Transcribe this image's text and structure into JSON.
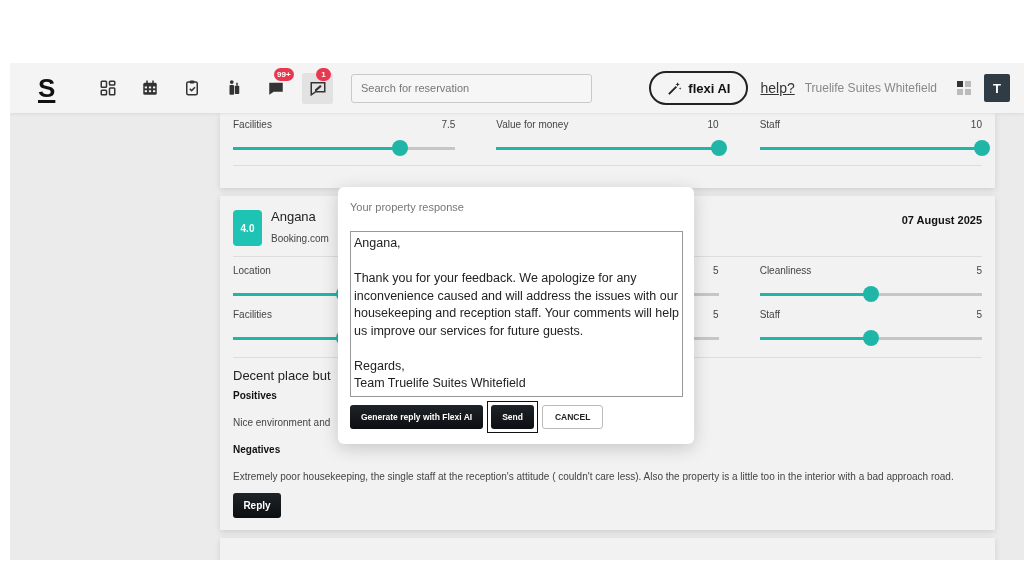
{
  "header": {
    "logo": "S",
    "nav": [
      {
        "kind": "dashboard",
        "selected": false
      },
      {
        "kind": "calendar",
        "selected": false
      },
      {
        "kind": "tasks",
        "selected": false
      },
      {
        "kind": "luggage",
        "selected": false
      },
      {
        "kind": "messages",
        "badge": "99+",
        "selected": false
      },
      {
        "kind": "reviews",
        "badge": "1",
        "selected": true
      }
    ],
    "search": {
      "placeholder": "Search for reservation"
    },
    "ai_button": "flexi AI",
    "help_link": "help?",
    "property_name": "Truelife Suites Whitefield",
    "avatar": "T"
  },
  "reviews": [
    {
      "ratings": [
        {
          "label": "Facilities",
          "value": "7.5",
          "level": 0.75
        },
        {
          "label": "Value for money",
          "value": "10",
          "level": 1
        },
        {
          "label": "Staff",
          "value": "10",
          "level": 1
        }
      ]
    },
    {
      "score": "4.0",
      "guest": "Angana",
      "source": "Booking.com",
      "date": "07 August 2025",
      "ratings": [
        {
          "label": "Location",
          "level": 0.5
        },
        {
          "value": "5",
          "level": 0.5
        },
        {
          "label": "Cleanliness",
          "value": "5",
          "level": 0.5
        },
        {
          "label": "Facilities",
          "level": 0.5
        },
        {
          "value": "5",
          "level": 0.5
        },
        {
          "label": "Staff",
          "value": "5",
          "level": 0.5
        }
      ],
      "title": "Decent place but",
      "sections": [
        {
          "heading": "Positives",
          "text": "Nice environment and"
        },
        {
          "heading": "Negatives",
          "text": "Extremely poor housekeeping, the single staff at the reception's attitude ( couldn't care less). Also the property is a little too in the interior with a bad approach road."
        }
      ],
      "reply_button": "Reply"
    }
  ],
  "modal": {
    "title": "Your property response",
    "response": "Angana,\n\nThank you for your feedback. We apologize for any inconvenience caused and will address the issues with our housekeeping and reception staff. Your comments will help us improve our services for future guests.\n\nRegards,\nTeam Truelife Suites Whitefield",
    "buttons": [
      {
        "label": "Generate reply with Flexi AI",
        "kind": "primary",
        "focused": false
      },
      {
        "label": "Send",
        "kind": "primary",
        "focused": true
      },
      {
        "label": "CANCEL",
        "kind": "secondary",
        "focused": false
      }
    ]
  }
}
